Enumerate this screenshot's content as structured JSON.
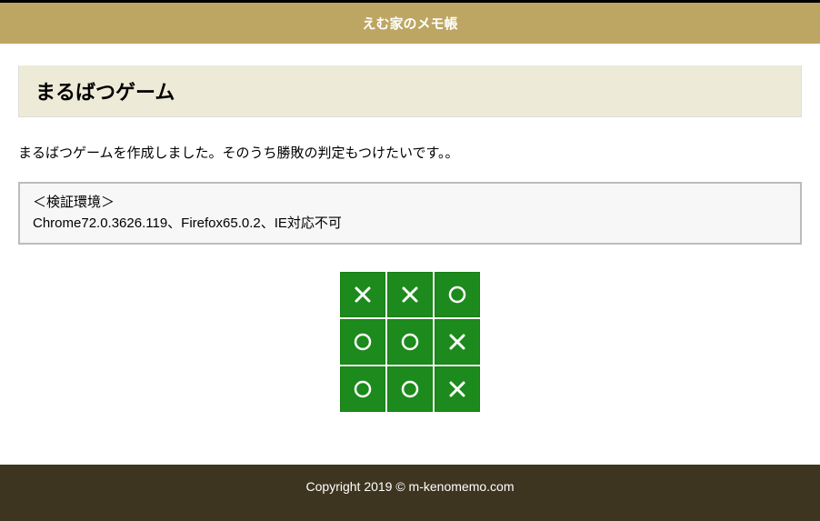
{
  "header": {
    "site_title": "えむ家のメモ帳"
  },
  "page": {
    "title": "まるばつゲーム",
    "description": "まるばつゲームを作成しました。そのうち勝敗の判定もつけたいです。。",
    "env_heading": "＜検証環境＞",
    "env_text": "Chrome72.0.3626.119、Firefox65.0.2、IE対応不可"
  },
  "board": {
    "cells": [
      "X",
      "X",
      "O",
      "O",
      "O",
      "X",
      "O",
      "O",
      "X"
    ]
  },
  "footer": {
    "copyright": "Copyright 2019 © m-kenomemo.com"
  },
  "chart_data": {
    "type": "table",
    "title": "Tic-Tac-Toe board state",
    "grid": [
      [
        "X",
        "X",
        "O"
      ],
      [
        "O",
        "O",
        "X"
      ],
      [
        "O",
        "O",
        "X"
      ]
    ]
  }
}
